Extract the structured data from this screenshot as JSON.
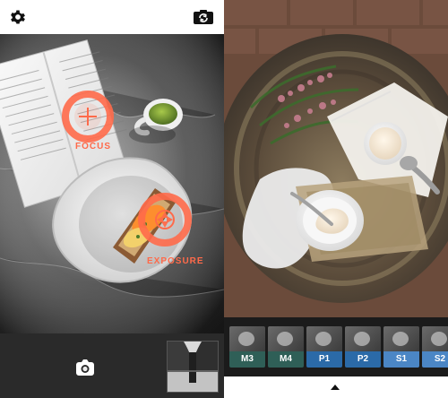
{
  "camera": {
    "focus_label": "FOCUS",
    "exposure_label": "EXPOSURE"
  },
  "filters": [
    {
      "code": "M3",
      "color": "#2f5f57"
    },
    {
      "code": "M4",
      "color": "#2f5f57"
    },
    {
      "code": "P1",
      "color": "#2b6aa8"
    },
    {
      "code": "P2",
      "color": "#2b6aa8"
    },
    {
      "code": "S1",
      "color": "#4b86c5"
    },
    {
      "code": "S2",
      "color": "#4b86c5"
    }
  ],
  "colors": {
    "accent": "#ff6a4a",
    "dark_bar": "#2a2a2a",
    "filters_bg": "#1b1b1b"
  },
  "icons": {
    "settings": "gear-icon",
    "switch_camera": "switch-camera-icon",
    "capture": "camera-icon",
    "collapse": "caret-up-icon"
  }
}
